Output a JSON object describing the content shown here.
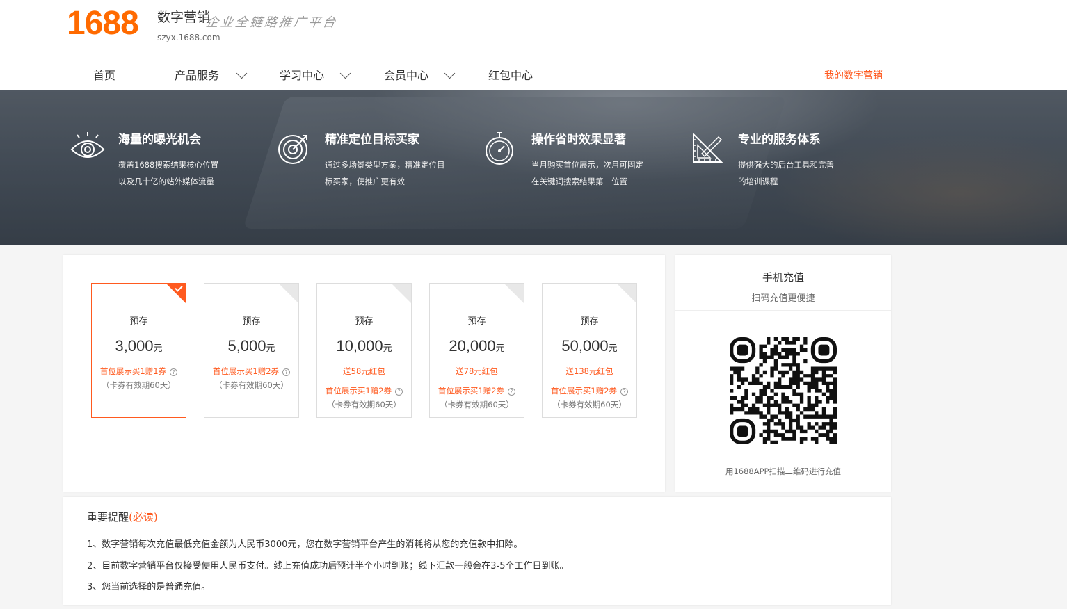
{
  "header": {
    "logo_number": "1688",
    "logo_title": "数字营销",
    "slogan": "企业全链路推广平台",
    "domain": "szyx.1688.com",
    "nav": [
      {
        "label": "首页"
      },
      {
        "label": "产品服务"
      },
      {
        "label": "学习中心"
      },
      {
        "label": "会员中心"
      },
      {
        "label": "红包中心"
      }
    ],
    "my_marketing": "我的数字营销"
  },
  "banner": {
    "features": [
      {
        "icon": "eye-icon",
        "title": "海量的曝光机会",
        "line1": "覆盖1688搜索结果核心位置",
        "line2": "以及几十亿的站外媒体流量"
      },
      {
        "icon": "target-icon",
        "title": "精准定位目标买家",
        "line1": "通过多场景类型方案，精准定位目",
        "line2": "标买家，使推广更有效"
      },
      {
        "icon": "stopwatch-icon",
        "title": "操作省时效果显著",
        "line1": "当月购买首位展示，次月可固定",
        "line2": "在关键词搜索结果第一位置"
      },
      {
        "icon": "ruler-icon",
        "title": "专业的服务体系",
        "line1": "提供强大的后台工具和完善",
        "line2": "的培训课程"
      }
    ]
  },
  "recharge": {
    "selected_index": 0,
    "cards": [
      {
        "pre": "预存",
        "amount": "3,000",
        "unit": "元",
        "redpack": "",
        "bonus": "首位展示买1赠1券",
        "valid": "（卡券有效期60天）"
      },
      {
        "pre": "预存",
        "amount": "5,000",
        "unit": "元",
        "redpack": "",
        "bonus": "首位展示买1赠2券",
        "valid": "（卡券有效期60天）"
      },
      {
        "pre": "预存",
        "amount": "10,000",
        "unit": "元",
        "redpack": "送58元红包",
        "bonus": "首位展示买1赠2券",
        "valid": "（卡券有效期60天）"
      },
      {
        "pre": "预存",
        "amount": "20,000",
        "unit": "元",
        "redpack": "送78元红包",
        "bonus": "首位展示买1赠2券",
        "valid": "（卡券有效期60天）"
      },
      {
        "pre": "预存",
        "amount": "50,000",
        "unit": "元",
        "redpack": "送138元红包",
        "bonus": "首位展示买1赠2券",
        "valid": "（卡券有效期60天）"
      }
    ]
  },
  "mobile": {
    "title": "手机充值",
    "subtitle": "扫码充值更便捷",
    "hint": "用1688APP扫描二维码进行充值"
  },
  "notice": {
    "title": "重要提醒",
    "must": "(必读)",
    "lines": [
      "1、数字营销每次充值最低充值金额为人民币3000元，您在数字营销平台产生的消耗将从您的充值款中扣除。",
      "2、目前数字营销平台仅接受使用人民币支付。线上充值成功后预计半个小时到账；线下汇款一般会在3-5个工作日到账。",
      "3、您当前选择的是普通充值。"
    ]
  },
  "colors": {
    "accent": "#ff6a00",
    "highlight": "#ff5a1f"
  }
}
